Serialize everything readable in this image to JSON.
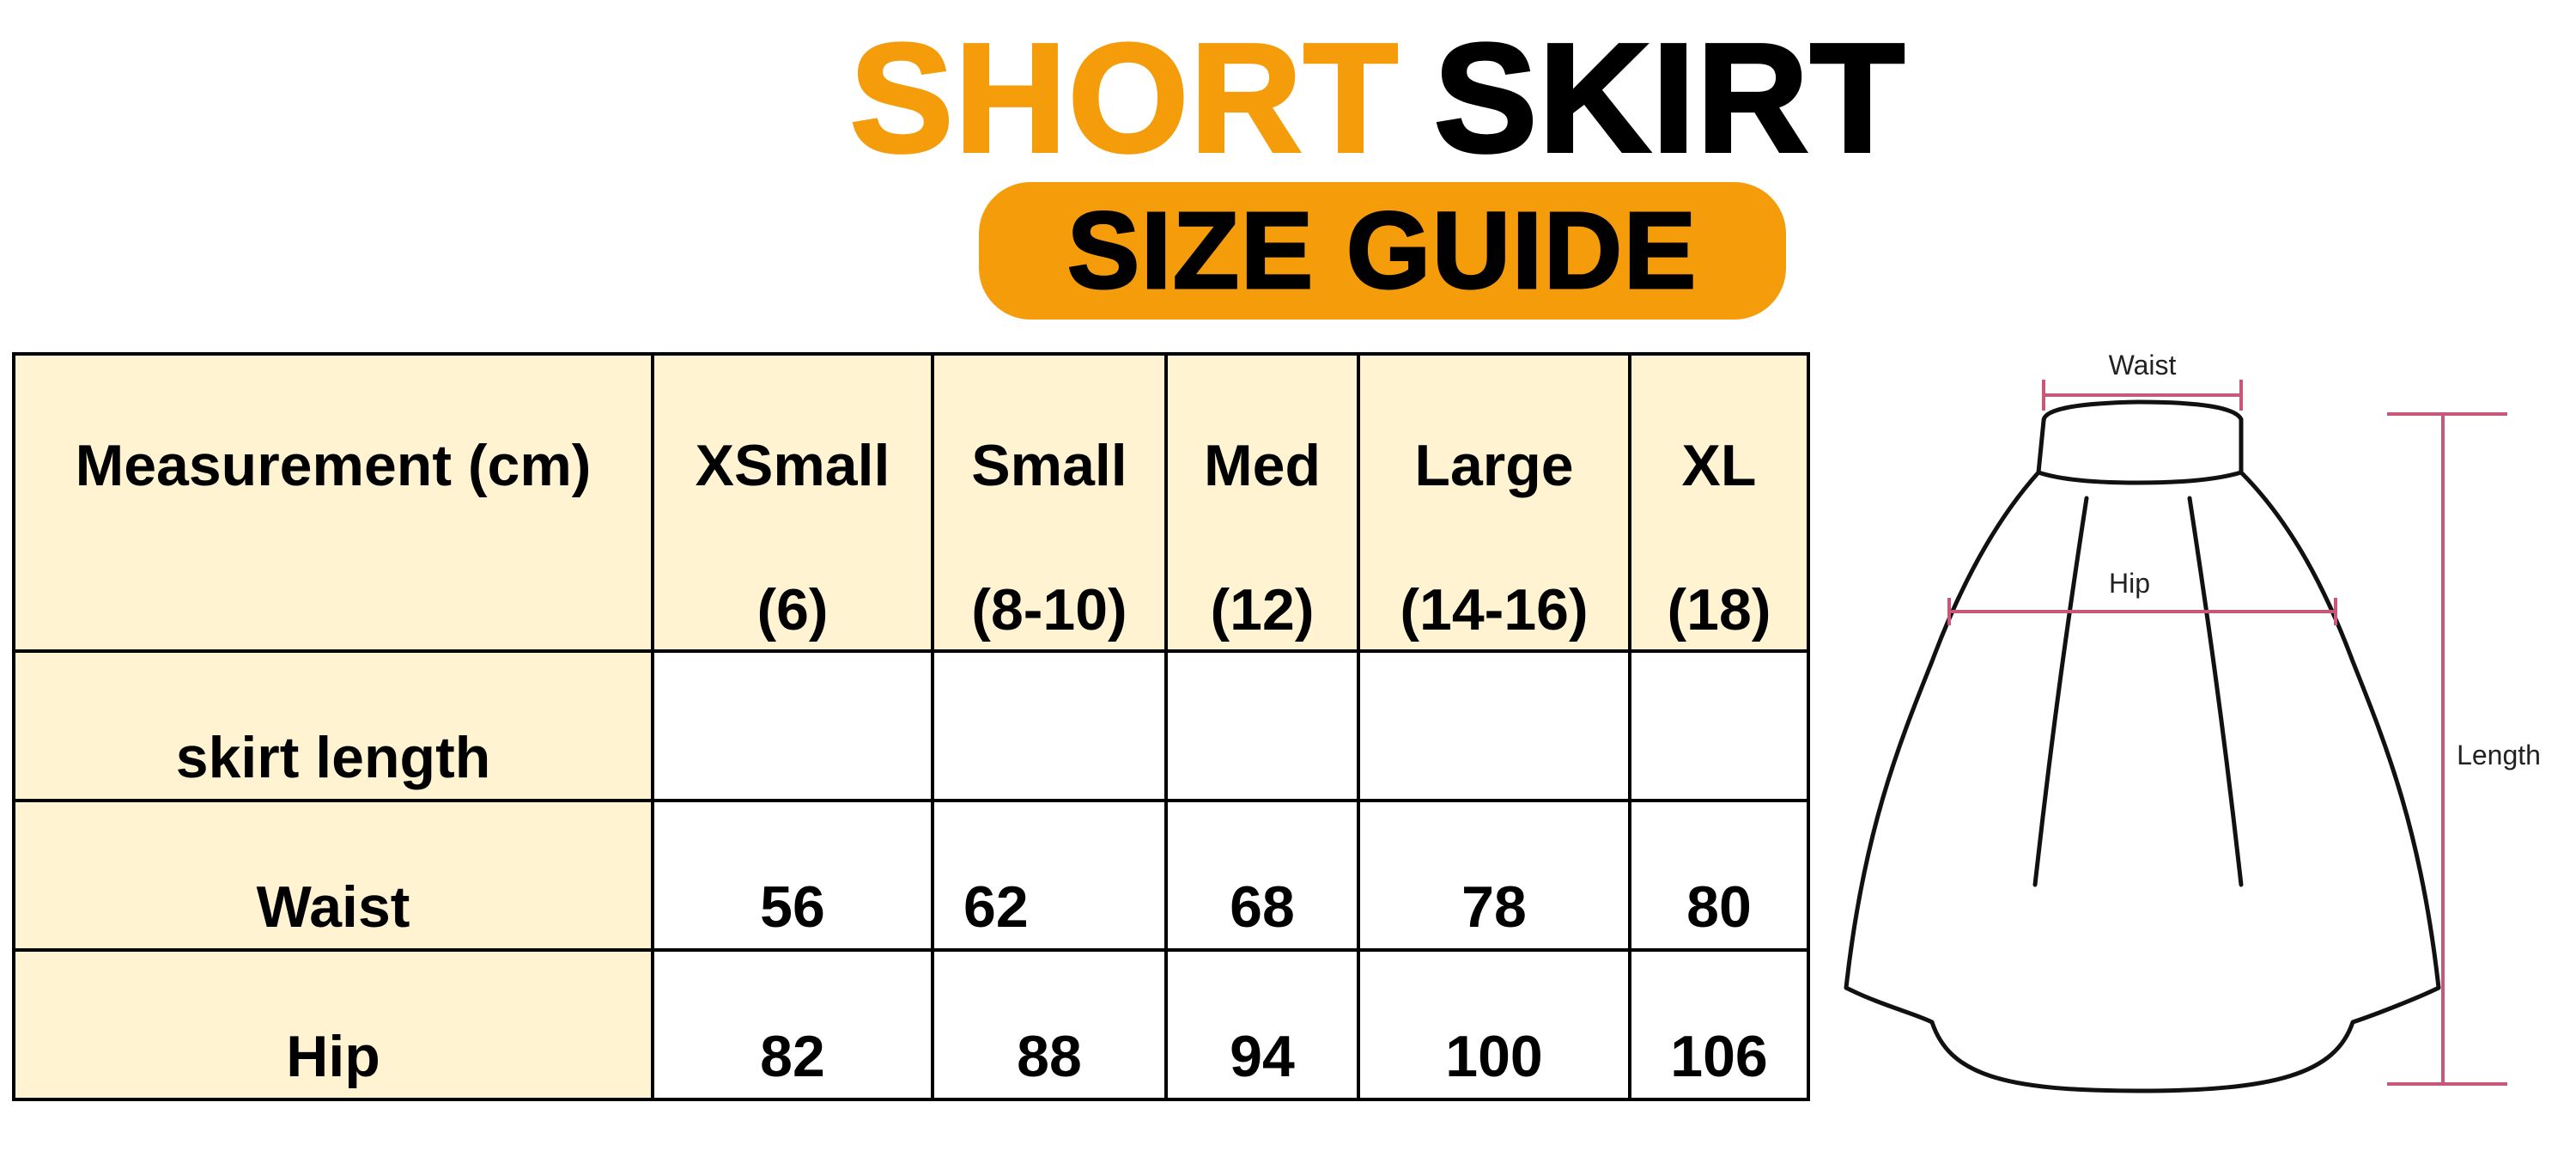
{
  "title": {
    "word1": "SHORT",
    "word2": "SKIRT",
    "badge": "SIZE GUIDE"
  },
  "colors": {
    "accent_orange": "#f59c0a",
    "cell_cream": "#fff3d1",
    "measure_line": "#c8587a"
  },
  "table": {
    "header_label": "Measurement (cm)",
    "sizes": [
      {
        "name": "XSmall",
        "number": "(6)"
      },
      {
        "name": "Small",
        "number": "(8-10)"
      },
      {
        "name": "Med",
        "number": "(12)"
      },
      {
        "name": "Large",
        "number": "(14-16)"
      },
      {
        "name": "XL",
        "number": "(18)"
      }
    ],
    "rows": [
      {
        "label": "skirt length",
        "values": [
          "",
          "",
          "",
          "",
          ""
        ]
      },
      {
        "label": "Waist",
        "values": [
          "56",
          "62",
          "68",
          "78",
          "80"
        ]
      },
      {
        "label": "Hip",
        "values": [
          "82",
          "88",
          "94",
          "100",
          "106"
        ]
      }
    ]
  },
  "diagram": {
    "waist_label": "Waist",
    "hip_label": "Hip",
    "length_label": "Length"
  }
}
